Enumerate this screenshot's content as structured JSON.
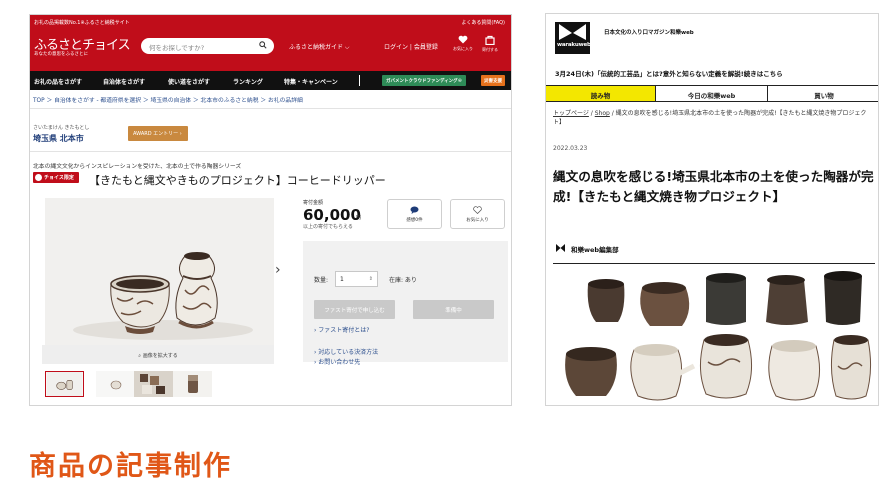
{
  "left": {
    "header": {
      "top_line": "お礼の品掲載数No.1※ふるさと納税サイト",
      "faq": "よくある質問(FAQ)",
      "logo": "ふるさとチョイス",
      "logo_sub": "あなたの意思をふるさとに",
      "search_placeholder": "何をお探しですか?",
      "guide": "ふるさと納税ガイド ⌵",
      "login": "ログイン | 会員登録",
      "favorites": "お気に入り",
      "donation_list": "寄付する"
    },
    "nav": {
      "items": [
        "お礼の品をさがす",
        "自治体をさがす",
        "使い道をさがす",
        "ランキング",
        "特集・キャンペーン"
      ],
      "gcf": "ガバメントクラウドファンディング®",
      "disaster": "災害支援"
    },
    "breadcrumb": "TOP ＞ 自治体をさがす - 都道府県を選択 ＞ 埼玉県の自治体 ＞ 北本市のふるさと納税 ＞ お礼の品詳細",
    "city_kana": "さいたまけん きたもとし",
    "city": "埼玉県 北本市",
    "award": "AWARD エントリー ›",
    "subtitle": "北本の縄文文化からインスピレーションを受けた、北本の土で作る陶器シリーズ",
    "badge": "チョイス限定",
    "title": "【きたもと縄文やきものプロジェクト】コーヒードリッパー",
    "zoom": "画像を拡大する",
    "amount_label": "寄付金額",
    "amount": "60,000",
    "amount_unit": "円",
    "amount_note": "以上の寄付でもらえる",
    "thanks_btn": "感想0件",
    "fav_btn": "お気に入り",
    "qty_label": "数量:",
    "qty_value": "1",
    "stock": "在庫: あり",
    "fast_btn": "ファスト寄付で申し込む",
    "prep_btn": "準備中",
    "links": [
      "› ファスト寄付とは?",
      "› 対応している決済方法",
      "› お問い合わせ先"
    ]
  },
  "right": {
    "logo": "warakuweb",
    "tagline": "日本文化の入り口マガジン和樂web",
    "news": "3月24日(木)「伝統的工芸品」とは?意外と知らない定義を解説!続きはこちら",
    "tabs": [
      "読み物",
      "今日の和樂web",
      "買い物"
    ],
    "breadcrumb_top": "トップページ",
    "breadcrumb_shop": "Shop",
    "breadcrumb_rest": "縄文の息吹を感じる!埼玉県北本市の土を使った陶器が完成!【きたもと縄文焼き物プロジェクト】",
    "date": "2022.03.23",
    "title": "縄文の息吹を感じる!埼玉県北本市の土を使った陶器が完成!【きたもと縄文焼き物プロジェクト】",
    "author": "和樂web編集部"
  },
  "caption": "商品の記事制作",
  "colors": {
    "brand_red": "#c00d1a",
    "wk_yellow": "#f3e700",
    "caption_orange": "#e05717"
  }
}
